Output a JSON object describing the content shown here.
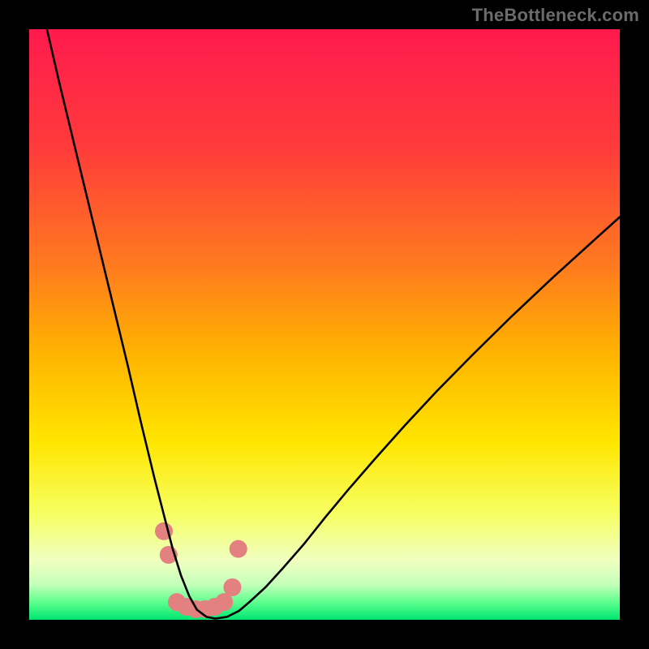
{
  "watermark": "TheBottleneck.com",
  "chart_data": {
    "type": "line",
    "title": "",
    "xlabel": "",
    "ylabel": "",
    "xlim": [
      0,
      100
    ],
    "ylim": [
      0,
      100
    ],
    "grid": false,
    "legend": false,
    "gradient_stops": [
      {
        "pos": 0.0,
        "color": "#ff1a4e"
      },
      {
        "pos": 0.2,
        "color": "#ff3b3b"
      },
      {
        "pos": 0.4,
        "color": "#ff7a1f"
      },
      {
        "pos": 0.55,
        "color": "#ffb400"
      },
      {
        "pos": 0.7,
        "color": "#ffe600"
      },
      {
        "pos": 0.82,
        "color": "#f6ff62"
      },
      {
        "pos": 0.9,
        "color": "#f0ffc0"
      },
      {
        "pos": 0.94,
        "color": "#c5ffba"
      },
      {
        "pos": 0.97,
        "color": "#5eff8e"
      },
      {
        "pos": 1.0,
        "color": "#00e570"
      }
    ],
    "series": [
      {
        "name": "bottleneck-curve",
        "color": "#000000",
        "x": [
          3.0,
          5.2,
          7.5,
          9.8,
          12.1,
          14.4,
          16.7,
          18.9,
          21.2,
          23.0,
          24.3,
          25.7,
          27.1,
          28.4,
          30.0,
          31.5,
          33.5,
          35.5,
          37.5,
          40.0,
          43.0,
          46.5,
          50.0,
          54.0,
          58.5,
          63.5,
          69.0,
          75.0,
          81.5,
          88.5,
          96.0,
          100.0
        ],
        "y": [
          100.0,
          90.5,
          81.0,
          71.5,
          62.0,
          52.5,
          43.0,
          33.5,
          24.0,
          17.0,
          12.0,
          7.5,
          4.0,
          1.7,
          0.5,
          0.2,
          0.5,
          1.5,
          3.2,
          5.5,
          8.8,
          12.8,
          17.2,
          22.0,
          27.2,
          32.8,
          38.7,
          44.8,
          51.2,
          57.8,
          64.6,
          68.2
        ]
      }
    ],
    "markers": {
      "name": "highlight-dots",
      "color": "#e38080",
      "radius": 11,
      "x": [
        22.8,
        23.6,
        25.0,
        26.6,
        28.2,
        29.8,
        31.4,
        33.0,
        34.4,
        35.4
      ],
      "y": [
        15.0,
        11.0,
        3.0,
        2.2,
        1.8,
        1.8,
        2.2,
        3.0,
        5.5,
        12.0
      ]
    }
  }
}
